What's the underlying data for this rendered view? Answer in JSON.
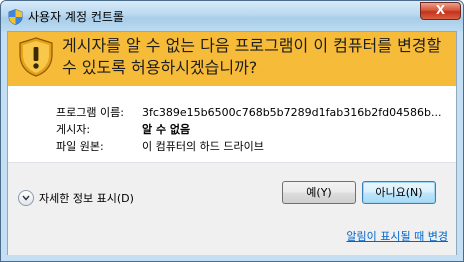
{
  "window": {
    "title": "사용자 계정 컨트롤",
    "close_label": "X"
  },
  "banner": {
    "question": "게시자를 알 수 없는 다음 프로그램이 이 컴퓨터를 변경할 수 있도록 허용하시겠습니까?"
  },
  "details": {
    "program_label": "프로그램 이름:",
    "program_value": "3fc389e15b6500c768b5b7289d1fab316b2fd04586b...",
    "publisher_label": "게시자:",
    "publisher_value": "알 수 없음",
    "origin_label": "파일 원본:",
    "origin_value": "이 컴퓨터의 하드 드라이브"
  },
  "footer": {
    "show_details_label": "자세한 정보 표시(D)",
    "yes_label": "예(Y)",
    "no_label": "아니요(N)",
    "notification_settings_link": "알림이 표시될 때 변경"
  },
  "colors": {
    "banner": "#f6bc39",
    "link": "#0066cc",
    "close": "#c5321b"
  }
}
